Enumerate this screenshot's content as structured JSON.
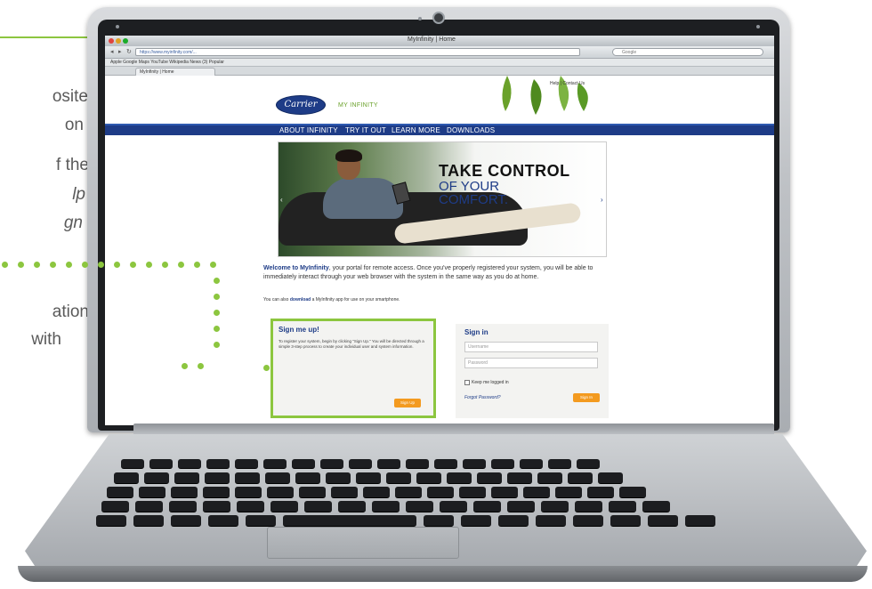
{
  "annotation": {
    "lines": [
      "osite",
      "on",
      "f the",
      "lp",
      "gn",
      "ation",
      "with"
    ]
  },
  "browser": {
    "title": "MyInfinity | Home",
    "url": "https://www.myinfinity.com/...",
    "search_placeholder": "Google",
    "tab_label": "MyInfinity | Home",
    "bookmarks": "Apple  Google Maps  YouTube  Wikipedia  News (3)  Popular"
  },
  "site": {
    "top_links": "Help | Contact Us",
    "logo_text": "Carrier",
    "brand_text": "MY INFINITY",
    "nav": [
      "ABOUT INFINITY",
      "TRY IT OUT",
      "LEARN MORE",
      "DOWNLOADS"
    ],
    "hero": {
      "line1": "TAKE CONTROL",
      "line2": "OF YOUR",
      "line3": "COMFORT.",
      "prev": "‹",
      "next": "›"
    },
    "welcome": {
      "lead": "Welcome to MyInfinity",
      "text": ", your portal for remote access. Once you've properly registered your system, you will be able to immediately interact through your web browser with the system in the same way as you do at home.",
      "small_pre": "You can also ",
      "small_link": "download",
      "small_post": " a MyInfinity app for use on your smartphone."
    },
    "signup": {
      "title": "Sign me up!",
      "body": "To register your system, begin by clicking \"Sign Up.\" You will be directed through a simple 3-step process to create your individual user and system information.",
      "button": "Sign Up"
    },
    "signin": {
      "title": "Sign in",
      "username_placeholder": "Username",
      "password_placeholder": "Password",
      "keep_logged_in": "Keep me logged in",
      "forgot": "Forgot Password?",
      "button": "Sign In"
    }
  },
  "colors": {
    "accent_green": "#8cc63f",
    "carrier_blue": "#1e3c87",
    "orange": "#f39a1f"
  }
}
